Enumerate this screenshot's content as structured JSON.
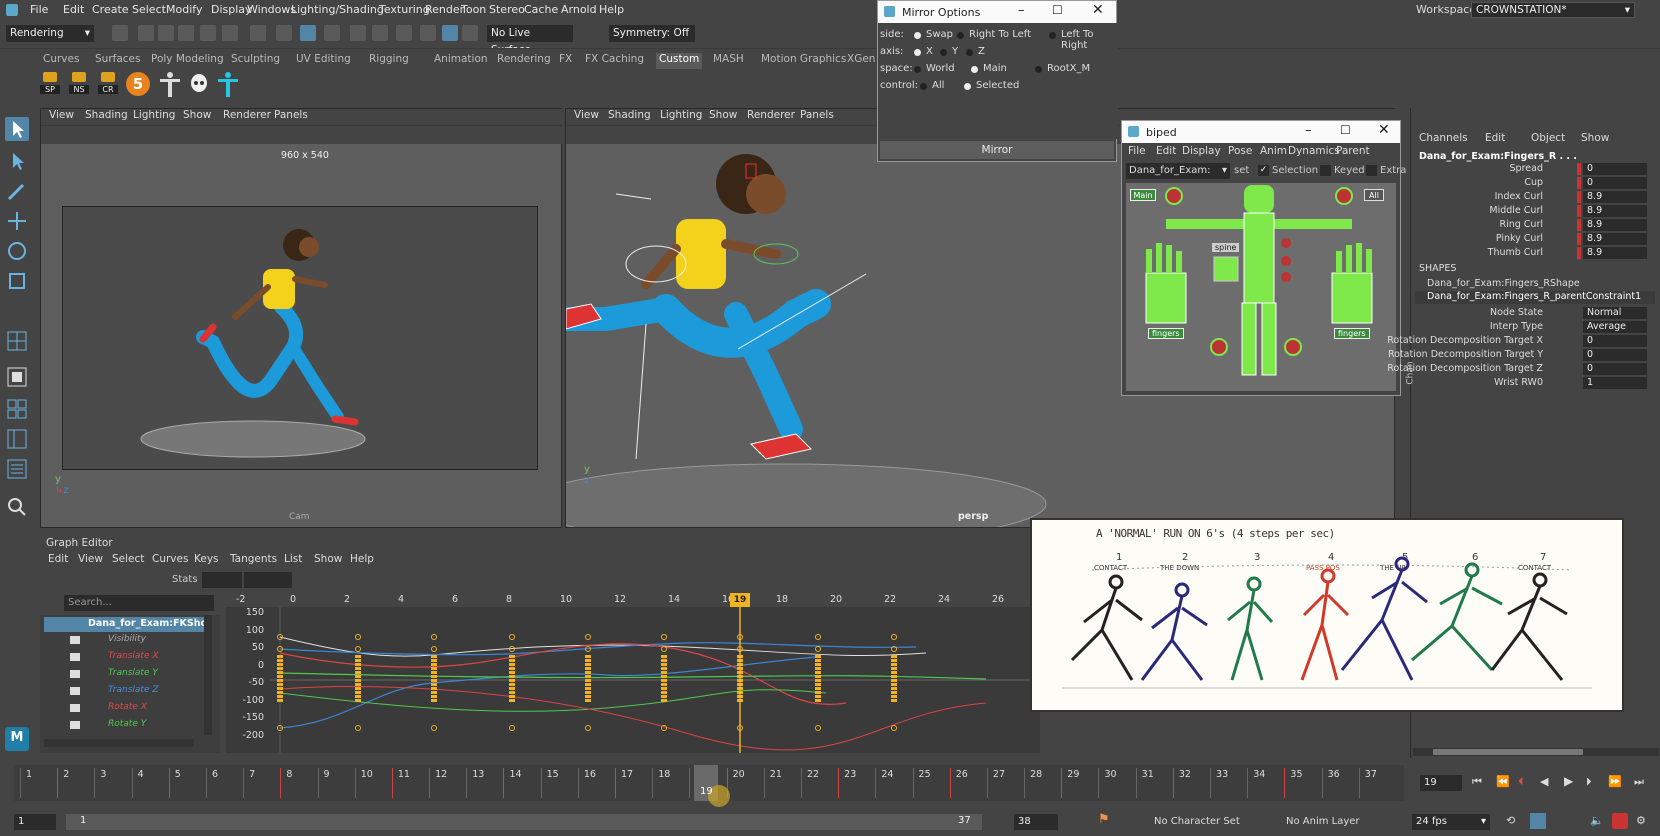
{
  "app": {
    "menu": [
      "File",
      "Edit",
      "Create",
      "Select",
      "Modify",
      "Display",
      "Windows",
      "Lighting/Shading",
      "Texturing",
      "Render",
      "Toon",
      "Stereo",
      "Cache",
      "Arnold",
      "Help"
    ],
    "mode": "Rendering",
    "live_surface": "No Live Surface",
    "symmetry": "Symmetry: Off",
    "workspace_label": "Workspace:",
    "workspace": "CROWNSTATION*"
  },
  "shelf": {
    "tabs": [
      "Curves",
      "Surfaces",
      "Poly Modeling",
      "Sculpting",
      "UV Editing",
      "Rigging",
      "Animation",
      "Rendering",
      "FX",
      "FX Caching",
      "Custom",
      "MASH",
      "Motion Graphics",
      "XGen"
    ],
    "active": "Custom",
    "items": [
      "SP",
      "NS",
      "CR",
      "5"
    ]
  },
  "viewport_left": {
    "menu": [
      "View",
      "Shading",
      "Lighting",
      "Show",
      "Renderer",
      "Panels"
    ],
    "resolution": "960 x 540",
    "camera": "Cam"
  },
  "viewport_right": {
    "menu": [
      "View",
      "Shading",
      "Lighting",
      "Show",
      "Renderer",
      "Panels"
    ],
    "camera": "persp"
  },
  "mirror_options": {
    "title": "Mirror Options",
    "rows": [
      {
        "label": "side:",
        "options": [
          "Swap",
          "Right To Left",
          "Left To Right"
        ]
      },
      {
        "label": "axis:",
        "options": [
          "X",
          "Y",
          "Z"
        ]
      },
      {
        "label": "space:",
        "options": [
          "World",
          "Main",
          "RootX_M"
        ]
      },
      {
        "label": "control:",
        "options": [
          "All",
          "Selected"
        ]
      }
    ],
    "button": "Mirror"
  },
  "biped": {
    "title": "biped",
    "menu": [
      "File",
      "Edit",
      "Display",
      "Pose",
      "Anim",
      "Dynamics",
      "Parent"
    ],
    "namespace": "Dana_for_Exam:",
    "set_label": "set",
    "selection": "Selection",
    "keyed": "Keyed",
    "extra": "Extra",
    "main_btn": "Main",
    "all_btn": "All",
    "spine": "spine",
    "fingers": "fingers"
  },
  "channels": {
    "menu": [
      "Channels",
      "Edit",
      "Object",
      "Show"
    ],
    "node": "Dana_for_Exam:Fingers_R . . .",
    "attrs": [
      {
        "name": "Spread",
        "value": "0"
      },
      {
        "name": "Cup",
        "value": "0"
      },
      {
        "name": "Index Curl",
        "value": "8.9"
      },
      {
        "name": "Middle Curl",
        "value": "8.9"
      },
      {
        "name": "Ring Curl",
        "value": "8.9"
      },
      {
        "name": "Pinky Curl",
        "value": "8.9"
      },
      {
        "name": "Thumb Curl",
        "value": "8.9"
      }
    ],
    "shapes_label": "SHAPES",
    "shape_name": "Dana_for_Exam:Fingers_RShape",
    "constraint_name": "Dana_for_Exam:Fingers_R_parentConstraint1",
    "const_attrs": [
      {
        "name": "Node State",
        "value": "Normal"
      },
      {
        "name": "Interp Type",
        "value": "Average"
      },
      {
        "name": "Rotation Decomposition Target X",
        "value": "0"
      },
      {
        "name": "Rotation Decomposition Target Y",
        "value": "0"
      },
      {
        "name": "Rotation Decomposition Target Z",
        "value": "0"
      },
      {
        "name": "Wrist RW0",
        "value": "1"
      }
    ],
    "side_tab": "Chan"
  },
  "graph_editor": {
    "title": "Graph Editor",
    "menu": [
      "Edit",
      "View",
      "Select",
      "Curves",
      "Keys",
      "Tangents",
      "List",
      "Show",
      "Help"
    ],
    "stats": "Stats",
    "search": "Search...",
    "node": "Dana_for_Exam:FKShoulde",
    "channels": [
      {
        "name": "Visibility",
        "color": "#aaaaaa"
      },
      {
        "name": "Translate X",
        "color": "#e04a4a"
      },
      {
        "name": "Translate Y",
        "color": "#4ec94e"
      },
      {
        "name": "Translate Z",
        "color": "#4a8ce0"
      },
      {
        "name": "Rotate X",
        "color": "#e04a4a"
      },
      {
        "name": "Rotate Y",
        "color": "#4ec94e"
      }
    ],
    "x_ticks": [
      "-2",
      "0",
      "2",
      "4",
      "6",
      "8",
      "10",
      "12",
      "14",
      "16",
      "18",
      "20",
      "22",
      "24",
      "26"
    ],
    "y_ticks": [
      "150",
      "100",
      "50",
      "0",
      "-50",
      "-100",
      "-150",
      "-200"
    ],
    "current": "19"
  },
  "reference": {
    "line1": "A 'NORMAL' RUN ON 6's (4 steps per sec)",
    "labels": [
      "1",
      "2",
      "3",
      "4",
      "5",
      "6",
      "7"
    ],
    "sub": [
      "CONTACT",
      "THE DOWN",
      "",
      "PASS POS",
      "THE UP",
      "",
      "CONTACT"
    ]
  },
  "timeline": {
    "frames": [
      "1",
      "2",
      "3",
      "4",
      "5",
      "6",
      "7",
      "8",
      "9",
      "10",
      "11",
      "12",
      "13",
      "14",
      "15",
      "16",
      "17",
      "18",
      "19",
      "20",
      "21",
      "22",
      "23",
      "24",
      "25",
      "26",
      "27",
      "28",
      "29",
      "30",
      "31",
      "32",
      "33",
      "34",
      "35",
      "36",
      "37"
    ],
    "current": "19",
    "current_field": "19"
  },
  "range": {
    "start": "1",
    "inner_start": "1",
    "inner_end": "37",
    "end": "38",
    "character_set": "No Character Set",
    "anim_layer": "No Anim Layer",
    "fps": "24 fps"
  },
  "colors": {
    "accent": "#5285a6",
    "key": "#f0b323",
    "green_ctrl": "#7fe84a"
  }
}
